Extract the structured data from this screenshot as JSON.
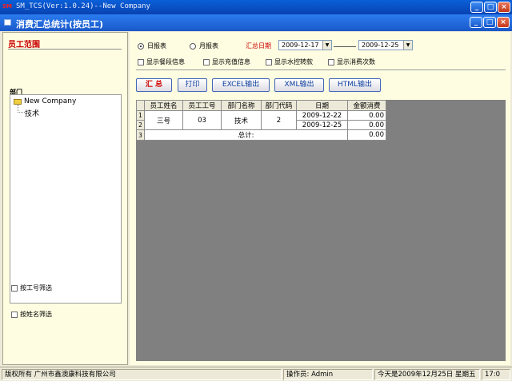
{
  "window": {
    "app_title": "SM_TCS(Ver:1.0.24)--New Company",
    "dialog_title": "消费汇总统计(按员工)"
  },
  "sidebar": {
    "heading": "员工范围",
    "tree_label": "部门",
    "tree": {
      "root": "New Company",
      "child": "技术"
    },
    "filter_by_id": "按工号筛选",
    "filter_by_name": "按姓名筛选"
  },
  "report_type": {
    "daily": "日报表",
    "monthly": "月报表",
    "selected": "daily"
  },
  "date_range": {
    "label": "汇总日期",
    "start": "2009-12-17",
    "end": "2009-12-25"
  },
  "options": [
    "显示餐段信息",
    "显示充值信息",
    "显示水控转款",
    "显示消费次数"
  ],
  "buttons": {
    "summary": "汇 总",
    "print": "打印",
    "excel": "EXCEL输出",
    "xml": "XML输出",
    "html": "HTML输出"
  },
  "grid": {
    "headers": [
      "员工姓名",
      "员工工号",
      "部门名称",
      "部门代码",
      "日期",
      "金额消费"
    ],
    "row_numbers": [
      "1",
      "2",
      "3"
    ],
    "employee": {
      "name": "三号",
      "id": "03",
      "dept": "技术",
      "dept_code": "2"
    },
    "rows": [
      {
        "date": "2009-12-22",
        "amount": "0.00"
      },
      {
        "date": "2009-12-25",
        "amount": "0.00"
      }
    ],
    "total_label": "总计:",
    "total_amount": "0.00"
  },
  "status": {
    "copyright": "版权所有 广州市鑫澳康科技有限公司",
    "operator": "操作员: Admin",
    "today": "今天是2009年12月25日 星期五",
    "time": "17:0"
  },
  "colors": {
    "title_blue": "#0a5fd8",
    "panel_bg": "#fffde1",
    "accent_red": "#c80000",
    "canvas_gray": "#808080"
  }
}
